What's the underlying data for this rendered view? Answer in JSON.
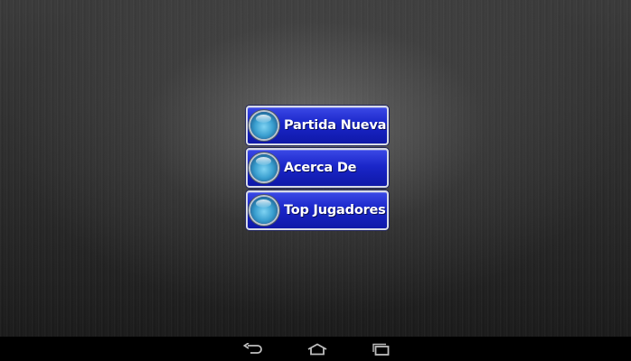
{
  "menu": {
    "buttons": [
      {
        "label": "Partida Nueva",
        "icon": "blue-orb-icon"
      },
      {
        "label": "Acerca De",
        "icon": "blue-orb-icon"
      },
      {
        "label": "Top Jugadores",
        "icon": "blue-orb-icon"
      }
    ]
  },
  "nav_bar": {
    "back_icon": "back-arrow-icon",
    "home_icon": "home-icon",
    "recents_icon": "recent-apps-icon"
  },
  "colors": {
    "button_blue": "#1a26c9",
    "button_border": "#d8dbe6",
    "orb_blue": "#3a9fd0",
    "background": "#2c2c2c",
    "nav_bar": "#000000"
  }
}
